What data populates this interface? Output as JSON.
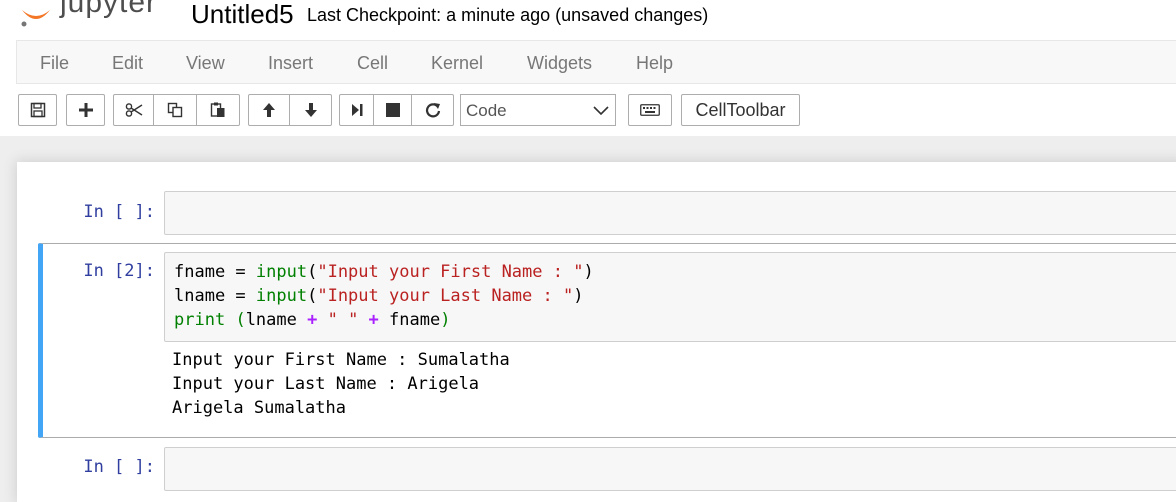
{
  "header": {
    "logo_text": "jupyter",
    "notebook_name": "Untitled5",
    "checkpoint_text": "Last Checkpoint: a minute ago (unsaved changes)"
  },
  "menubar": {
    "items": [
      "File",
      "Edit",
      "View",
      "Insert",
      "Cell",
      "Kernel",
      "Widgets",
      "Help"
    ]
  },
  "toolbar": {
    "cell_type": "Code",
    "celltoolbar_label": "CellToolbar",
    "icons": [
      "save-icon",
      "insert-cell-below-icon",
      "cut-icon",
      "copy-icon",
      "paste-icon",
      "move-up-icon",
      "move-down-icon",
      "run-icon",
      "stop-icon",
      "restart-icon",
      "keyboard-icon"
    ]
  },
  "cells": [
    {
      "prompt": "In [ ]:"
    },
    {
      "prompt": "In [2]:",
      "code": {
        "line1": {
          "var": "fname",
          "eq": " = ",
          "fn": "input",
          "open": "(",
          "str": "\"Input your First Name : \"",
          "close": ")"
        },
        "line2": {
          "var": "lname",
          "eq": " = ",
          "fn": "input",
          "open": "(",
          "str": "\"Input your Last Name : \"",
          "close": ")"
        },
        "line3": {
          "fn": "print",
          "sp": " ",
          "open": "(",
          "a": "lname",
          "plus1": " + ",
          "str": "\" \"",
          "plus2": " + ",
          "b": "fname",
          "close": ")"
        }
      },
      "output": [
        "Input your First Name : Sumalatha",
        "Input your Last Name : Arigela",
        "Arigela Sumalatha"
      ]
    },
    {
      "prompt": "In [ ]:"
    }
  ],
  "colors": {
    "selected_border": "#42a5f5",
    "prompt": "#303f9f",
    "builtin": "#008000",
    "string": "#ba2121",
    "operator": "#aa22ff"
  }
}
